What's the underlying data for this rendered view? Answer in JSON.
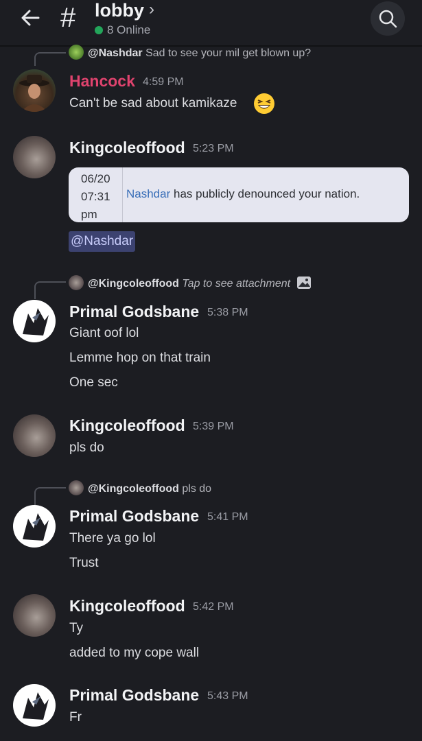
{
  "header": {
    "channel_name": "lobby",
    "online_text": "8 Online",
    "hash": "#"
  },
  "reply1": {
    "mention": "@Nashdar",
    "text": "Sad to see your mil get blown up?"
  },
  "m1": {
    "author": "Hancock",
    "time": "4:59 PM",
    "lines": [
      "Can't be sad about kamikaze"
    ],
    "author_color": "#e0436e"
  },
  "m2": {
    "author": "Kingcoleoffood",
    "time": "5:23 PM",
    "embed": {
      "date_line1": "06/20",
      "date_line2": "07:31",
      "date_line3": "pm",
      "link": "Nashdar",
      "text": "has publicly denounced your nation."
    },
    "mention": "@Nashdar"
  },
  "reply2": {
    "mention": "@Kingcoleoffood",
    "text": "Tap to see attachment"
  },
  "m3": {
    "author": "Primal Godsbane",
    "time": "5:38 PM",
    "lines": [
      "Giant oof lol",
      "Lemme hop on that train",
      "One sec"
    ]
  },
  "m4": {
    "author": "Kingcoleoffood",
    "time": "5:39 PM",
    "lines": [
      "pls do"
    ]
  },
  "reply3": {
    "mention": "@Kingcoleoffood",
    "text": "pls do"
  },
  "m5": {
    "author": "Primal Godsbane",
    "time": "5:41 PM",
    "lines": [
      "There ya go lol",
      "Trust"
    ]
  },
  "m6": {
    "author": "Kingcoleoffood",
    "time": "5:42 PM",
    "lines": [
      "Ty",
      "added to my cope wall"
    ]
  },
  "m7": {
    "author": "Primal Godsbane",
    "time": "5:43 PM",
    "lines": [
      "Fr"
    ]
  }
}
